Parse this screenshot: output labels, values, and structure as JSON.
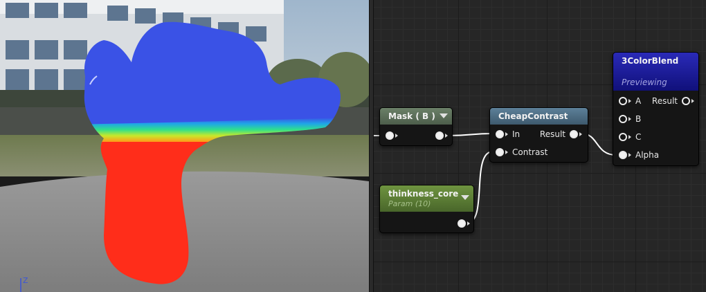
{
  "viewport": {
    "axis_label": "Z"
  },
  "graph": {
    "nodes": {
      "mask": {
        "title": "Mask ( B )"
      },
      "param": {
        "title": "thinkness_core",
        "subtitle": "Param (10)"
      },
      "contrast": {
        "title": "CheapContrast",
        "in_label": "In",
        "contrast_label": "Contrast",
        "result_label": "Result"
      },
      "blend": {
        "title": "3ColorBlend",
        "status": "Previewing",
        "a_label": "A",
        "b_label": "B",
        "c_label": "C",
        "alpha_label": "Alpha",
        "result_label": "Result"
      }
    },
    "colors": {
      "mask_header": "#5a6e58",
      "param_header": "#5d7f2f",
      "contrast_header": "#4a6d85",
      "blend_header": "#1e1ea8",
      "wire": "#ffffff"
    }
  }
}
